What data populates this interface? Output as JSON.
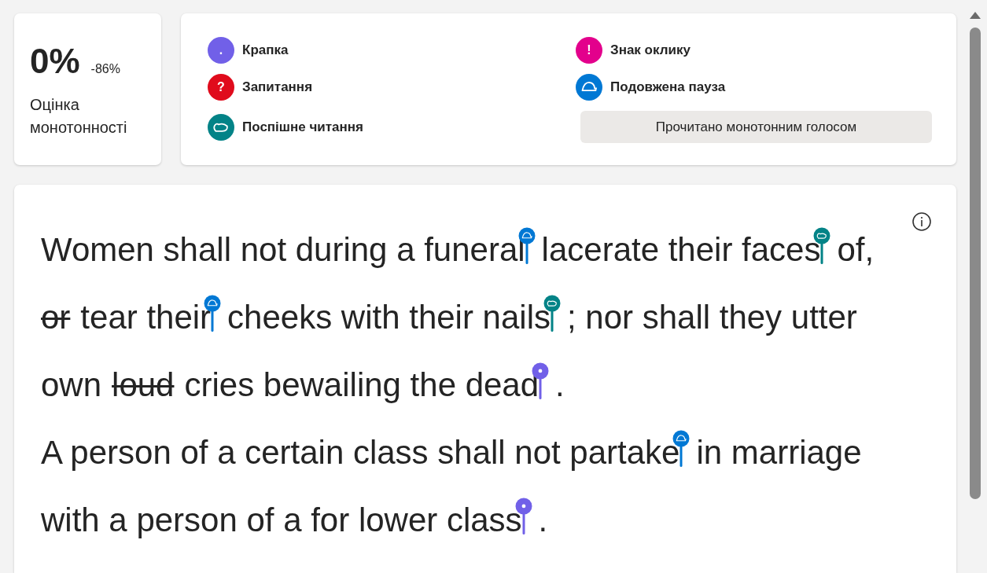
{
  "score": {
    "value": "0%",
    "change": "-86%",
    "label": "Оцінка монотонності"
  },
  "legend": {
    "items": [
      {
        "kind": "period",
        "symbol": ".",
        "label": "Крапка",
        "color": "#7160e8"
      },
      {
        "kind": "exclamation",
        "symbol": "!",
        "label": "Знак оклику",
        "color": "#e3008c"
      },
      {
        "kind": "question",
        "symbol": "?",
        "label": "Запитання",
        "color": "#e00b1c"
      },
      {
        "kind": "pause",
        "label": "Подовжена пауза",
        "color": "#0078d4"
      },
      {
        "kind": "rushed",
        "label": "Поспішне читання",
        "color": "#038387"
      }
    ],
    "button": "Прочитано монотонним голосом"
  },
  "passage": [
    [
      {
        "kind": "text",
        "text": "Women shall not during a funeral"
      },
      {
        "kind": "pause"
      },
      {
        "kind": "text",
        "text": "lacerate their faces"
      },
      {
        "kind": "rushed"
      },
      {
        "kind": "text",
        "text": "of,"
      }
    ],
    [
      {
        "kind": "struck",
        "text": "or"
      },
      {
        "kind": "text",
        "text": "tear their"
      },
      {
        "kind": "pause"
      },
      {
        "kind": "text",
        "text": "cheeks with their nails"
      },
      {
        "kind": "rushed"
      },
      {
        "kind": "text",
        "text": "; nor shall they utter"
      }
    ],
    [
      {
        "kind": "text",
        "text": "own"
      },
      {
        "kind": "struck",
        "text": "loud"
      },
      {
        "kind": "text",
        "text": "cries bewailing the dead"
      },
      {
        "kind": "period"
      },
      {
        "kind": "text",
        "text": "."
      }
    ],
    [
      {
        "kind": "text",
        "text": "A person of a certain class shall not partake"
      },
      {
        "kind": "pause"
      },
      {
        "kind": "text",
        "text": "in marriage"
      }
    ],
    [
      {
        "kind": "text",
        "text": "with a person of a for lower class"
      },
      {
        "kind": "period"
      },
      {
        "kind": "text",
        "text": "."
      }
    ]
  ]
}
